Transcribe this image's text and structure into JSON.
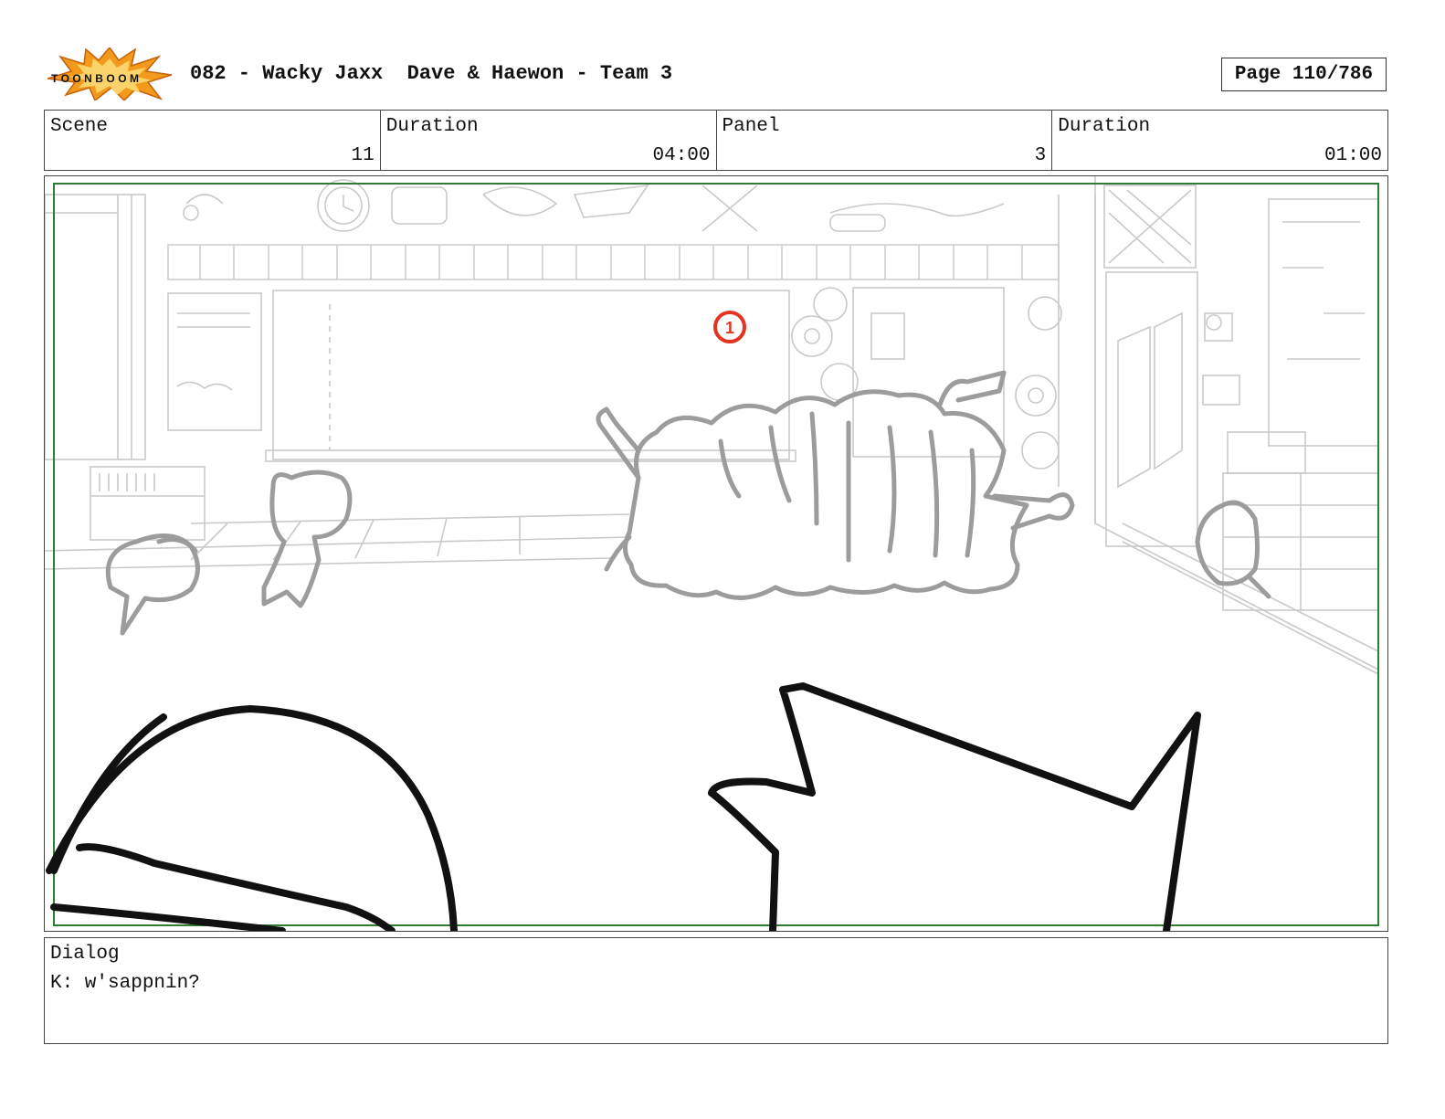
{
  "header": {
    "logo_text": "TOONBOOM",
    "title": "082 - Wacky Jaxx  Dave & Haewon - Team 3",
    "page": "Page 110/786"
  },
  "info": {
    "scene_label": "Scene",
    "scene_value": "11",
    "scene_duration_label": "Duration",
    "scene_duration_value": "04:00",
    "panel_label": "Panel",
    "panel_value": "3",
    "panel_duration_label": "Duration",
    "panel_duration_value": "01:00"
  },
  "panel_art": {
    "description_icons": [
      "classroom-background-icon",
      "characters-sketch-icon"
    ],
    "annotation_number": "1",
    "safe_frame_color": "#2e7d32",
    "annotation_color": "#e53322"
  },
  "dialog": {
    "label": "Dialog",
    "text": "K: w'sappnin?"
  }
}
